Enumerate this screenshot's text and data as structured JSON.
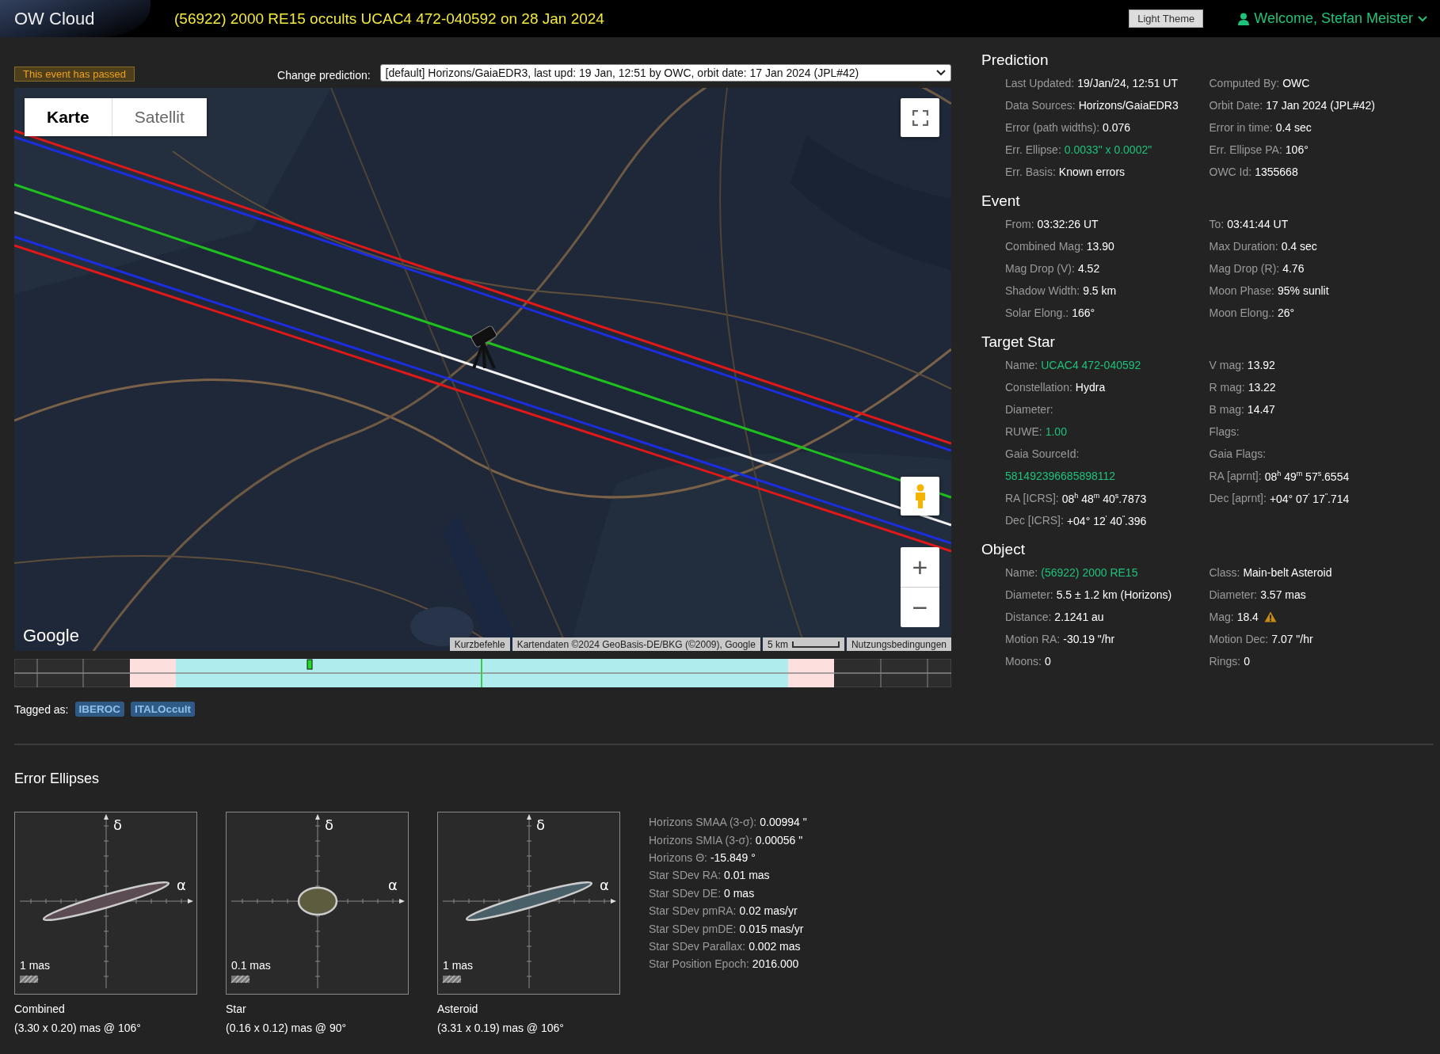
{
  "header": {
    "logo": "OW Cloud",
    "title": "(56922) 2000 RE15 occults UCAC4 472-040592 on 28 Jan 2024",
    "theme_button": "Light Theme",
    "welcome": "Welcome, Stefan Meister"
  },
  "status_badge": "This event has passed",
  "prediction_selector": {
    "label": "Change prediction:",
    "value": "[default] Horizons/GaiaEDR3, last upd: 19 Jan, 12:51 by OWC, orbit date: 17 Jan 2024 (JPL#42)"
  },
  "map": {
    "kind": "picture",
    "map_types": [
      {
        "label": "Karte",
        "selected": true
      },
      {
        "label": "Satellit",
        "selected": false
      }
    ],
    "zoom_controls": [
      "+",
      "−"
    ],
    "logo": "Google",
    "attribution": [
      {
        "text": "Kurzbefehle",
        "kind": "link"
      },
      {
        "text": "Kartendaten ©2024 GeoBasis-DE/BKG (©2009), Google",
        "kind": "text"
      },
      {
        "text": "5 km",
        "kind": "scale"
      },
      {
        "text": "Nutzungsbedingungen",
        "kind": "link"
      }
    ]
  },
  "tags": {
    "label": "Tagged as:",
    "items": [
      "IBEROC",
      "ITALOccult"
    ]
  },
  "sections": [
    {
      "title": "Prediction",
      "left": [
        {
          "label": "Last Updated:",
          "value": "19/Jan/24, 12:51 UT"
        },
        {
          "label": "Data Sources:",
          "value": "Horizons/GaiaEDR3"
        },
        {
          "label": "Error (path widths):",
          "value": "0.076"
        },
        {
          "label": "Err. Ellipse:",
          "value": "0.0033\" x 0.0002\"",
          "kind": "link"
        },
        {
          "label": "Err. Basis:",
          "value": "Known errors"
        }
      ],
      "right": [
        {
          "label": "Computed By:",
          "value": "OWC"
        },
        {
          "label": "Orbit Date:",
          "value": "17 Jan 2024 (JPL#42)"
        },
        {
          "label": "Error in time:",
          "value": "0.4 sec"
        },
        {
          "label": "Err. Ellipse PA:",
          "value": "106°"
        },
        {
          "label": "OWC Id:",
          "value": "1355668"
        }
      ]
    },
    {
      "title": "Event",
      "left": [
        {
          "label": "From:",
          "value": "03:32:26 UT"
        },
        {
          "label": "Combined Mag:",
          "value": "13.90"
        },
        {
          "label": "Mag Drop (V):",
          "value": "4.52"
        },
        {
          "label": "Shadow Width:",
          "value": "9.5 km"
        },
        {
          "label": "Solar Elong.:",
          "value": "166°"
        }
      ],
      "right": [
        {
          "label": "To:",
          "value": "03:41:44 UT"
        },
        {
          "label": "Max Duration:",
          "value": "0.4 sec"
        },
        {
          "label": "Mag Drop (R):",
          "value": "4.76"
        },
        {
          "label": "Moon Phase:",
          "value": "95% sunlit"
        },
        {
          "label": "Moon Elong.:",
          "value": "26°"
        }
      ]
    },
    {
      "title": "Target Star",
      "left": [
        {
          "label": "Name:",
          "value": "UCAC4 472-040592",
          "kind": "link"
        },
        {
          "label": "Constellation:",
          "value": "Hydra"
        },
        {
          "label": "Diameter:"
        },
        {
          "label": "RUWE:",
          "value": "1.00",
          "kind": "link"
        },
        {
          "label": "Gaia SourceId:"
        },
        {
          "value": "581492396685898112",
          "kind": "link"
        },
        {
          "label": "RA [ICRS]:",
          "value": "08$^{h}$ 48$^{m}$ 40$^{s}$.7873"
        },
        {
          "label": "Dec [ICRS]:",
          "value": "+04° 12$^{'}$ 40$^{\"}$.396"
        }
      ],
      "right": [
        {
          "label": "V mag:",
          "value": "13.92"
        },
        {
          "label": "R mag:",
          "value": "13.22"
        },
        {
          "label": "B mag:",
          "value": "14.47"
        },
        {
          "label": "Flags:"
        },
        {
          "label": "Gaia Flags:"
        },
        {
          "label": "RA [aprnt]:",
          "value": "08$^{h}$ 49$^{m}$ 57$^{s}$.6554"
        },
        {
          "label": "Dec [aprnt]:",
          "value": "+04° 07$^{'}$ 17$^{\"}$.714"
        }
      ]
    },
    {
      "title": "Object",
      "left": [
        {
          "label": "Name:",
          "value": "(56922) 2000 RE15",
          "kind": "link"
        },
        {
          "label": "Diameter:",
          "value": "5.5 ± 1.2 km  (Horizons)"
        },
        {
          "label": "Distance:",
          "value": "2.1241 au"
        },
        {
          "label": "Motion RA:",
          "value": "-30.19 \"/hr"
        },
        {
          "label": "Moons:",
          "value": "0"
        }
      ],
      "right": [
        {
          "label": "Class:",
          "value": "Main-belt Asteroid"
        },
        {
          "label": "Diameter:",
          "value": "3.57 mas"
        },
        {
          "label": "Mag:",
          "value": "18.4",
          "warning": true
        },
        {
          "label": "Motion Dec:",
          "value": "7.07 \"/hr"
        },
        {
          "label": "Rings:",
          "value": "0"
        }
      ]
    }
  ],
  "error_ellipses": {
    "title": "Error Ellipses",
    "plots": [
      {
        "axis_y": "δ",
        "axis_x": "α",
        "scale": "1 mas",
        "caption": "Combined",
        "dims": "(3.30 x 0.20) mas @ 106°",
        "color": "#5b4b53",
        "kind": "elongated"
      },
      {
        "axis_y": "δ",
        "axis_x": "α",
        "scale": "0.1 mas",
        "caption": "Star",
        "dims": "(0.16 x 0.12) mas @ 90°",
        "color": "#5d5c3e",
        "kind": "round"
      },
      {
        "axis_y": "δ",
        "axis_x": "α",
        "scale": "1 mas",
        "caption": "Asteroid",
        "dims": "(3.31 x 0.19) mas @ 106°",
        "color": "#4a6068",
        "kind": "elongated"
      }
    ],
    "stats": [
      {
        "label": "Horizons SMAA (3-σ):",
        "value": "0.00994 \""
      },
      {
        "label": "Horizons SMIA (3-σ):",
        "value": "0.00056 \""
      },
      {
        "label": "Horizons Θ:",
        "value": "-15.849 °"
      },
      {
        "label": "Star SDev RA:",
        "value": "0.01 mas"
      },
      {
        "label": "Star SDev DE:",
        "value": "0 mas"
      },
      {
        "label": "Star SDev pmRA:",
        "value": "0.02 mas/yr"
      },
      {
        "label": "Star SDev pmDE:",
        "value": "0.015 mas/yr"
      },
      {
        "label": "Star SDev Parallax:",
        "value": "0.002 mas"
      },
      {
        "label": "Star Position Epoch:",
        "value": "2016.000"
      }
    ]
  }
}
